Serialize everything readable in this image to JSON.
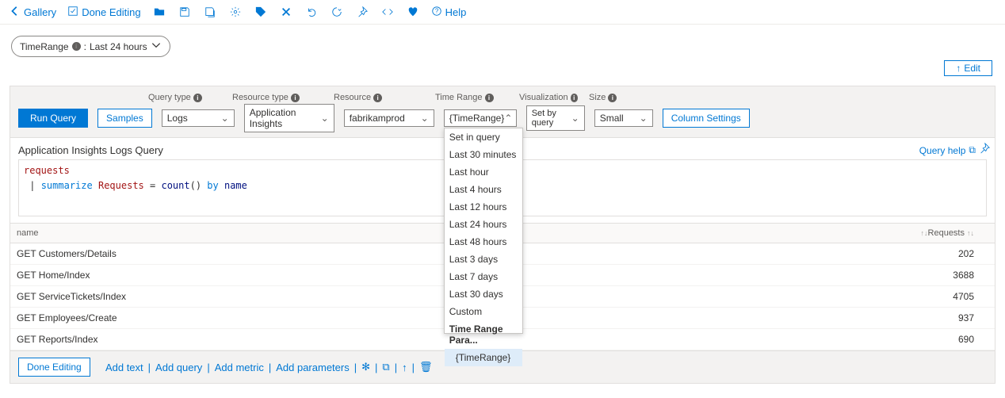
{
  "toolbar": {
    "gallery": "Gallery",
    "done_editing": "Done Editing",
    "help": "Help"
  },
  "pill": {
    "name": "TimeRange",
    "value": "Last 24 hours"
  },
  "edit_btn": "Edit",
  "labels": {
    "query_type": "Query type",
    "resource_type": "Resource type",
    "resource": "Resource",
    "time_range": "Time Range",
    "visualization": "Visualization",
    "size": "Size"
  },
  "buttons": {
    "run_query": "Run Query",
    "samples": "Samples",
    "column_settings": "Column Settings"
  },
  "selects": {
    "query_type": "Logs",
    "resource_type": "Application Insights",
    "resource": "fabrikamprod",
    "time_range": "{TimeRange}",
    "visualization": "Set by query",
    "size": "Small"
  },
  "time_range_options": [
    {
      "label": "Set in query"
    },
    {
      "label": "Last 30 minutes"
    },
    {
      "label": "Last hour"
    },
    {
      "label": "Last 4 hours"
    },
    {
      "label": "Last 12 hours"
    },
    {
      "label": "Last 24 hours"
    },
    {
      "label": "Last 48 hours"
    },
    {
      "label": "Last 3 days"
    },
    {
      "label": "Last 7 days"
    },
    {
      "label": "Last 30 days"
    },
    {
      "label": "Custom"
    },
    {
      "label": "Time Range Para...",
      "bold": true
    },
    {
      "label": "{TimeRange}",
      "sub": true
    }
  ],
  "query": {
    "title": "Application Insights Logs Query",
    "help": "Query help",
    "line1_table": "requests",
    "line2_pipe": "|",
    "line2_kw1": "summarize",
    "line2_id": "Requests",
    "line2_eq": "=",
    "line2_fn": "count",
    "line2_paren": "()",
    "line2_kw2": "by",
    "line2_id2": "name"
  },
  "columns": {
    "name": "name",
    "requests": "Requests"
  },
  "rows": [
    {
      "name": "GET Customers/Details",
      "requests": "202"
    },
    {
      "name": "GET Home/Index",
      "requests": "3688"
    },
    {
      "name": "GET ServiceTickets/Index",
      "requests": "4705"
    },
    {
      "name": "GET Employees/Create",
      "requests": "937"
    },
    {
      "name": "GET Reports/Index",
      "requests": "690"
    }
  ],
  "footer": {
    "done_editing": "Done Editing",
    "add_text": "Add text",
    "add_query": "Add query",
    "add_metric": "Add metric",
    "add_parameters": "Add parameters"
  }
}
